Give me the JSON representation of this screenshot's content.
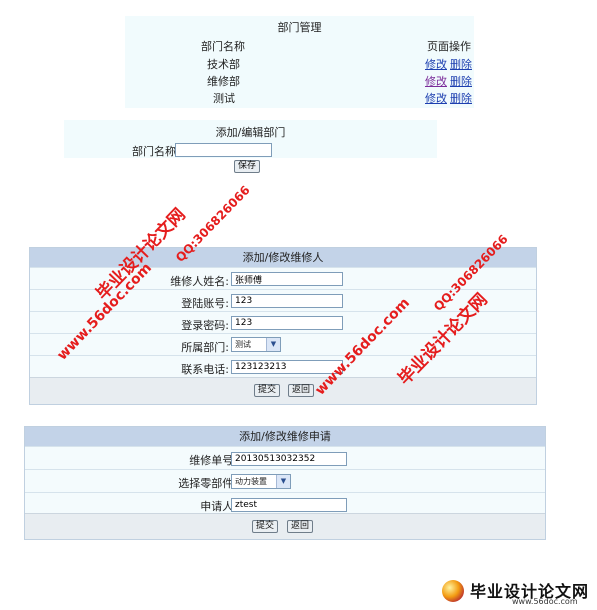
{
  "dept_panel": {
    "title": "部门管理",
    "col_name": "部门名称",
    "col_ops": "页面操作",
    "rows": [
      {
        "name": "技术部",
        "edit": "修改",
        "delete": "删除"
      },
      {
        "name": "维修部",
        "edit": "修改",
        "delete": "删除"
      },
      {
        "name": "测试",
        "edit": "修改",
        "delete": "删除"
      }
    ]
  },
  "dept_form": {
    "title": "添加/编辑部门",
    "label": "部门名称",
    "value": "",
    "save": "保存"
  },
  "repairer_form": {
    "title": "添加/修改维修人",
    "fields": [
      {
        "label": "维修人姓名:",
        "value": "张师傅"
      },
      {
        "label": "登陆账号:",
        "value": "123"
      },
      {
        "label": "登录密码:",
        "value": "123"
      },
      {
        "label": "所属部门:",
        "value": "测试"
      },
      {
        "label": "联系电话:",
        "value": "123123213"
      }
    ],
    "submit": "提交",
    "back": "返回"
  },
  "request_form": {
    "title": "添加/修改维修申请",
    "fields": [
      {
        "label": "维修单号:",
        "value": "20130513032352"
      },
      {
        "label": "选择零部件:",
        "value": "动力装置"
      },
      {
        "label": "申请人:",
        "value": "ztest"
      }
    ],
    "submit": "提交",
    "back": "返回"
  },
  "watermarks": {
    "site_cn": "毕业设计论文网",
    "url": "www.56doc.com",
    "qq": "QQ:306826066",
    "logo_cn": "毕业设计论文网",
    "logo_url": "www.56doc.com"
  },
  "colors": {
    "panel_header": "#c3d3e8",
    "watermark_red": "#e51d1d",
    "link": "#1d3fb0"
  }
}
